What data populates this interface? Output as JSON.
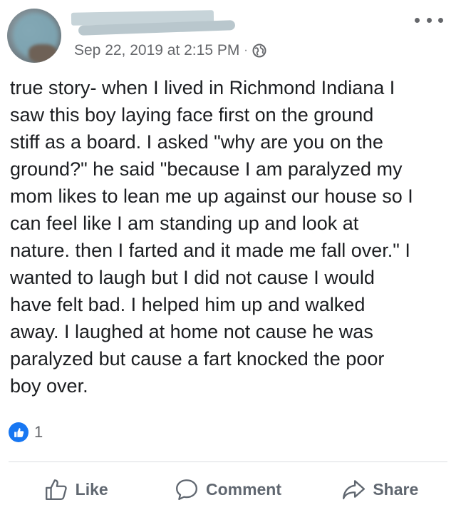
{
  "post": {
    "timestamp": "Sep 22, 2019 at 2:15 PM",
    "separator": "·",
    "privacy_icon": "globe-icon",
    "text": "true story- when I lived in Richmond Indiana I\nsaw this boy laying face first on the ground\nstiff as a board. I asked \"why are you on the\nground?\" he said \"because I am paralyzed my\nmom likes to lean me up against our house so I\ncan feel like I am standing up and look at\nnature. then I farted and it made me fall over.\" I\nwanted to laugh but I did not cause I would\nhave felt bad. I helped him up and walked\naway. I laughed at home not cause he was\nparalyzed but cause a fart knocked the poor\nboy over."
  },
  "reactions": {
    "icon": "like-reaction-icon",
    "count": "1"
  },
  "actions": {
    "like_label": "Like",
    "comment_label": "Comment",
    "share_label": "Share"
  },
  "colors": {
    "accent": "#1877f2",
    "secondary_text": "#65676b",
    "action_text": "#606770"
  }
}
